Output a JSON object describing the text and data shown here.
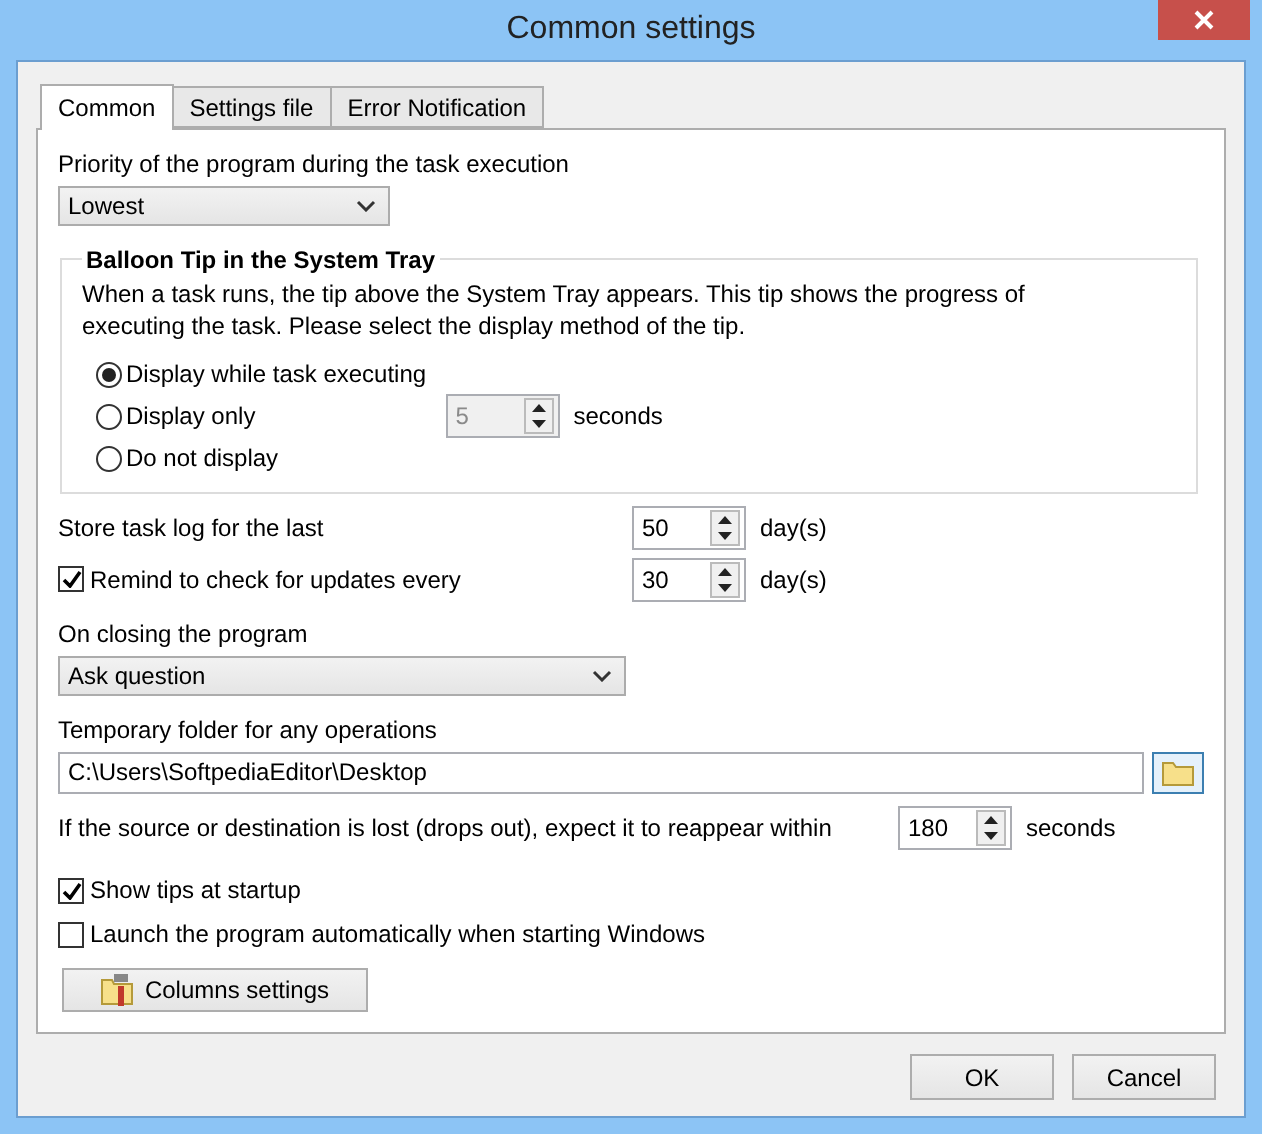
{
  "window": {
    "title": "Common settings"
  },
  "tabs": [
    {
      "label": "Common",
      "selected": true
    },
    {
      "label": "Settings file",
      "selected": false
    },
    {
      "label": "Error Notification",
      "selected": false
    }
  ],
  "priority": {
    "label": "Priority of the program during the task execution",
    "value": "Lowest"
  },
  "balloon": {
    "title": "Balloon Tip in the System Tray",
    "description": "When a task runs, the tip above the System Tray appears. This tip shows the progress of executing the task. Please select the display method of the tip.",
    "options": [
      {
        "label": "Display while task executing",
        "selected": true
      },
      {
        "label": "Display only",
        "selected": false
      },
      {
        "label": "Do not display",
        "selected": false
      }
    ],
    "spinner": {
      "value": "5",
      "disabled": true
    },
    "unit": "seconds"
  },
  "store_log": {
    "label": "Store task log for the last",
    "value": "50",
    "unit": "day(s)"
  },
  "remind": {
    "label": "Remind to check for updates every",
    "checked": true,
    "value": "30",
    "unit": "day(s)"
  },
  "on_closing": {
    "label": "On closing the program",
    "value": "Ask question"
  },
  "temp_folder": {
    "label": "Temporary folder for any operations",
    "value": "C:\\Users\\SoftpediaEditor\\Desktop"
  },
  "reappear": {
    "label": "If the source or destination is lost (drops out), expect it to reappear within",
    "value": "180",
    "unit": "seconds"
  },
  "checkboxes": [
    {
      "label": "Show tips at startup",
      "checked": true
    },
    {
      "label": "Launch the program automatically when starting Windows",
      "checked": false
    }
  ],
  "columns_button": "Columns settings",
  "buttons": [
    "OK",
    "Cancel"
  ]
}
